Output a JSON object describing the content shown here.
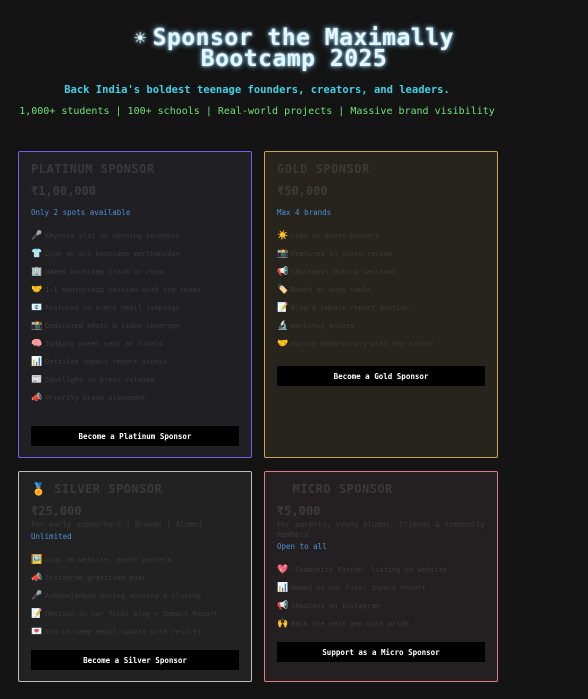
{
  "hero": {
    "icon": "sun-icon",
    "title_line1": "Sponsor the Maximally",
    "title_line2": "Bootcamp 2025",
    "tagline": "Back India's boldest teenage founders, creators, and leaders.",
    "stats": "1,000+ students | 100+ schools | Real-world projects | Massive brand visibility"
  },
  "tiers": {
    "platinum": {
      "title": "PLATINUM SPONSOR",
      "price": "₹1,00,000",
      "availability": "Only 2 spots available",
      "items": [
        {
          "icon": "🎤",
          "text": "Keynote slot at opening ceremony"
        },
        {
          "icon": "👕",
          "text": "Logo on all bootcamp merchandise"
        },
        {
          "icon": "🏢",
          "text": "Named bootcamp track or room"
        },
        {
          "icon": "🤝",
          "text": "1:1 mentorship session with top teams"
        },
        {
          "icon": "📧",
          "text": "Featured in every email campaign"
        },
        {
          "icon": "📸",
          "text": "Dedicated photo & video coverage"
        },
        {
          "icon": "🧠",
          "text": "Judging panel seat at finals"
        },
        {
          "icon": "📊",
          "text": "Detailed impact report access"
        },
        {
          "icon": "📰",
          "text": "Spotlight in press release"
        },
        {
          "icon": "📣",
          "text": "Priority brand placement"
        }
      ],
      "cta": "Become a Platinum Sponsor"
    },
    "gold": {
      "title": "GOLD SPONSOR",
      "price": "₹50,000",
      "availability": "Max 4 brands",
      "items": [
        {
          "icon": "☀️",
          "text": "Logo on event banners"
        },
        {
          "icon": "📸",
          "text": "Featured in photo recaps"
        },
        {
          "icon": "📢",
          "text": "Shoutouts during sessions"
        },
        {
          "icon": "🏷️",
          "text": "Booth or swag table"
        },
        {
          "icon": "📝",
          "text": "Blog & impact report mention"
        },
        {
          "icon": "🔬",
          "text": "Workshop access"
        },
        {
          "icon": "🤝",
          "text": "Hiring opportunity with top talent"
        }
      ],
      "cta": "Become a Gold Sponsor"
    },
    "silver": {
      "title": "SILVER SPONSOR",
      "icon": "medal-icon",
      "price": "₹25,000",
      "subtitle": "For early supporters | Brands | Alumni",
      "availability": "Unlimited",
      "items": [
        {
          "icon": "🖼️",
          "text": "Logo on website, event posters"
        },
        {
          "icon": "📣",
          "text": "Instagram gratitude post"
        },
        {
          "icon": "🎤",
          "text": "Acknowledged during opening & closing"
        },
        {
          "icon": "📝",
          "text": "Mention in our final blog + Impact Report"
        },
        {
          "icon": "💌",
          "text": "End-of-camp email update with results"
        }
      ],
      "cta": "Become a Silver Sponsor"
    },
    "micro": {
      "title": "MICRO SPONSOR",
      "icon": "heart-icon",
      "price": "₹5,000",
      "subtitle": "For parents, young alumni, friends & community members",
      "availability": "Open to all",
      "items": [
        {
          "icon": "💖",
          "text": "\"Community Patron\" listing on website"
        },
        {
          "icon": "📊",
          "text": "Named in our Final Impact Report"
        },
        {
          "icon": "📢",
          "text": "Shoutout on Instagram"
        },
        {
          "icon": "🙌",
          "text": "Back the next gen with pride"
        }
      ],
      "cta": "Support as a Micro Sponsor"
    }
  }
}
